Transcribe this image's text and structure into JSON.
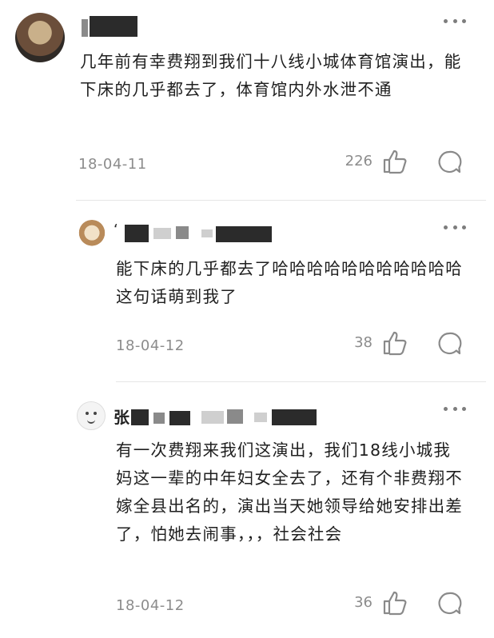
{
  "comments": [
    {
      "text": "几年前有幸费翔到我们十八线小城体育馆演出，能下床的几乎都去了，体育馆内外水泄不通",
      "date": "18-04-11",
      "likes": "226"
    },
    {
      "name_visible": "‘",
      "text": "能下床的几乎都去了哈哈哈哈哈哈哈哈哈哈哈这句话萌到我了",
      "date": "18-04-12",
      "likes": "38"
    },
    {
      "name_visible": "张",
      "text": "有一次费翔来我们这演出，我们18线小城我妈这一辈的中年妇女全去了，还有个非费翔不嫁全县出名的，演出当天她领导给她安排出差了，怕她去闹事，，，社会社会",
      "date": "18-04-12",
      "likes": "36"
    }
  ],
  "icons": {
    "more": "more-dots-icon",
    "like": "thumbs-up-icon",
    "reply": "comment-bubble-icon"
  }
}
